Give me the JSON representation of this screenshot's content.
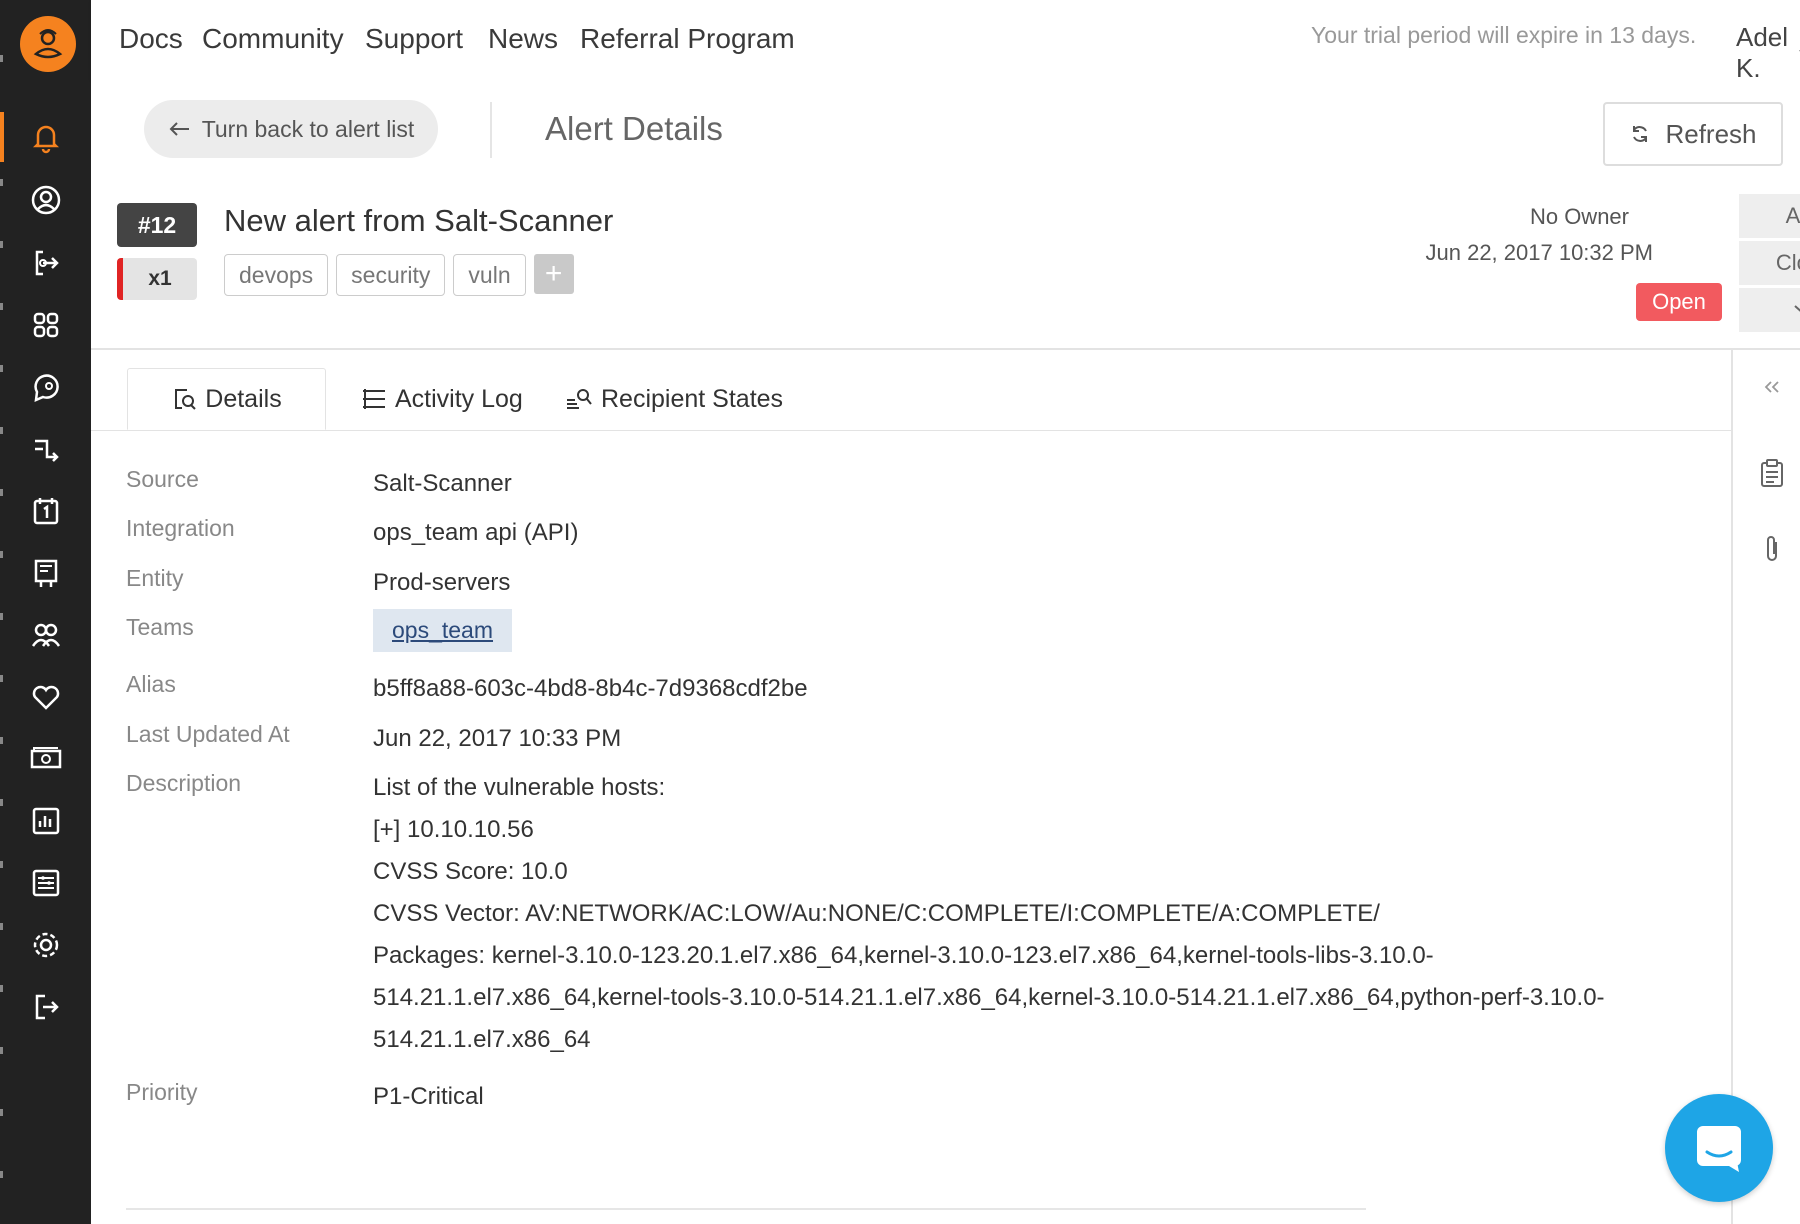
{
  "sidebar": {
    "logo": "opsgenie-logo",
    "items": [
      "bell-icon",
      "user-circle-icon",
      "integrations-icon",
      "heartbeat-shortcut-icon",
      "chat-icon",
      "routing-icon",
      "calendar-icon",
      "board-icon",
      "teams-icon",
      "heart-icon",
      "billing-icon",
      "analytics-icon",
      "settings-list-icon",
      "gear-icon",
      "logout-icon"
    ],
    "active_index": 0,
    "accent_color": "#f5821f"
  },
  "topbar": {
    "nav": [
      "Docs",
      "Community",
      "Support",
      "News",
      "Referral Program"
    ],
    "trial_text": "Your trial period will expire in 13 days.",
    "user_name": "Adel K."
  },
  "subheader": {
    "back_label": "Turn back to alert list",
    "title": "Alert Details",
    "refresh_label": "Refresh"
  },
  "alert": {
    "number": "#12",
    "count": "x1",
    "title": "New alert from Salt-Scanner",
    "tags": [
      "devops",
      "security",
      "vuln"
    ],
    "add_tag": "+",
    "owner": "No Owner",
    "created": "Jun 22, 2017 10:32 PM",
    "status": "Open",
    "status_color": "#f25a5f",
    "actions": {
      "ack": "Ack",
      "close": "Close"
    }
  },
  "tabs": [
    {
      "label": "Details",
      "icon": "details-icon"
    },
    {
      "label": "Activity Log",
      "icon": "list-icon"
    },
    {
      "label": "Recipient States",
      "icon": "recipient-icon"
    }
  ],
  "details": {
    "source": {
      "label": "Source",
      "value": "Salt-Scanner"
    },
    "integration": {
      "label": "Integration",
      "value": "ops_team api (API)"
    },
    "entity": {
      "label": "Entity",
      "value": "Prod-servers"
    },
    "teams": {
      "label": "Teams",
      "value": "ops_team"
    },
    "alias": {
      "label": "Alias",
      "value": "b5ff8a88-603c-4bd8-8b4c-7d9368cdf2be"
    },
    "last_updated": {
      "label": "Last Updated At",
      "value": "Jun 22, 2017 10:33 PM"
    },
    "description": {
      "label": "Description",
      "lines": [
        "List of the vulnerable hosts:",
        "[+] 10.10.10.56",
        "CVSS Score: 10.0",
        "CVSS Vector: AV:NETWORK/AC:LOW/Au:NONE/C:COMPLETE/I:COMPLETE/A:COMPLETE/",
        "Packages: kernel-3.10.0-123.20.1.el7.x86_64,kernel-3.10.0-123.el7.x86_64,kernel-tools-libs-3.10.0-",
        "514.21.1.el7.x86_64,kernel-tools-3.10.0-514.21.1.el7.x86_64,kernel-3.10.0-514.21.1.el7.x86_64,python-perf-3.10.0-",
        "514.21.1.el7.x86_64"
      ]
    },
    "priority": {
      "label": "Priority",
      "value": "P1-Critical"
    }
  },
  "right_rail": [
    "collapse-icon",
    "notes-icon",
    "attachment-icon"
  ],
  "chat_button": "chat-messenger-icon"
}
